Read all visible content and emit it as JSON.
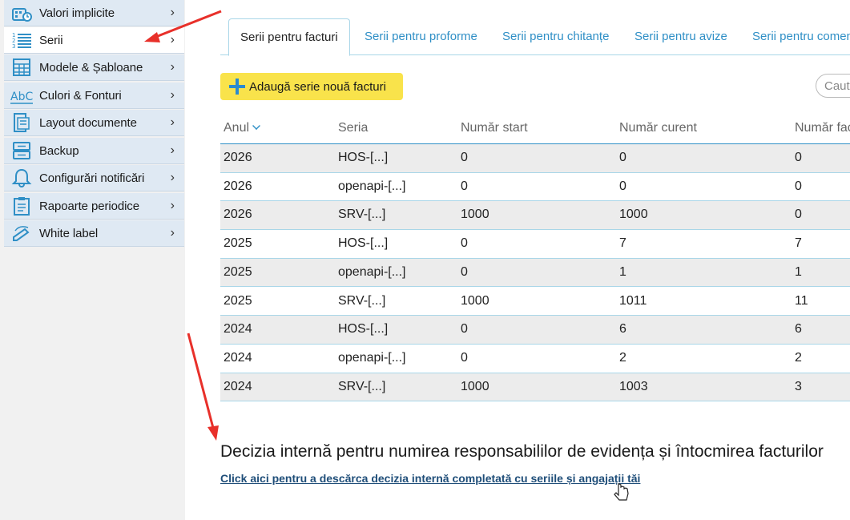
{
  "sidebar": {
    "items": [
      {
        "label": "Valori implicite",
        "icon": "calculator-icon"
      },
      {
        "label": "Serii",
        "icon": "numbered-list-icon"
      },
      {
        "label": "Modele & Șabloane",
        "icon": "template-grid-icon"
      },
      {
        "label": "Culori & Fonturi",
        "icon": "abc-font-icon"
      },
      {
        "label": "Layout documente",
        "icon": "document-layout-icon"
      },
      {
        "label": "Backup",
        "icon": "server-backup-icon"
      },
      {
        "label": "Configurări notificări",
        "icon": "bell-icon"
      },
      {
        "label": "Rapoarte periodice",
        "icon": "clipboard-icon"
      },
      {
        "label": "White label",
        "icon": "pen-paper-icon"
      }
    ],
    "chevron": "›"
  },
  "tabs": [
    {
      "label": "Serii pentru facturi"
    },
    {
      "label": "Serii pentru proforme"
    },
    {
      "label": "Serii pentru chitanțe"
    },
    {
      "label": "Serii pentru avize"
    },
    {
      "label": "Serii pentru comenzi"
    }
  ],
  "toolbar": {
    "add_label": "Adaugă serie nouă facturi",
    "search_placeholder": "Caut"
  },
  "table": {
    "headers": [
      "Anul",
      "Seria",
      "Număr start",
      "Număr curent",
      "Număr facturi"
    ],
    "rows": [
      [
        "2026",
        "HOS-[...]",
        "0",
        "0",
        "0"
      ],
      [
        "2026",
        "openapi-[...]",
        "0",
        "0",
        "0"
      ],
      [
        "2026",
        "SRV-[...]",
        "1000",
        "1000",
        "0"
      ],
      [
        "2025",
        "HOS-[...]",
        "0",
        "7",
        "7"
      ],
      [
        "2025",
        "openapi-[...]",
        "0",
        "1",
        "1"
      ],
      [
        "2025",
        "SRV-[...]",
        "1000",
        "1011",
        "11"
      ],
      [
        "2024",
        "HOS-[...]",
        "0",
        "6",
        "6"
      ],
      [
        "2024",
        "openapi-[...]",
        "0",
        "2",
        "2"
      ],
      [
        "2024",
        "SRV-[...]",
        "1000",
        "1003",
        "3"
      ]
    ]
  },
  "decision": {
    "heading": "Decizia internă pentru numirea responsabililor de evidența și întocmirea facturilor",
    "link": "Click aici pentru a descărca decizia internă completată cu seriile și angajații tăi"
  },
  "colors": {
    "accent": "#2f8fc6",
    "add_button": "#f9e34b",
    "annotation_arrow": "#e8302a"
  }
}
